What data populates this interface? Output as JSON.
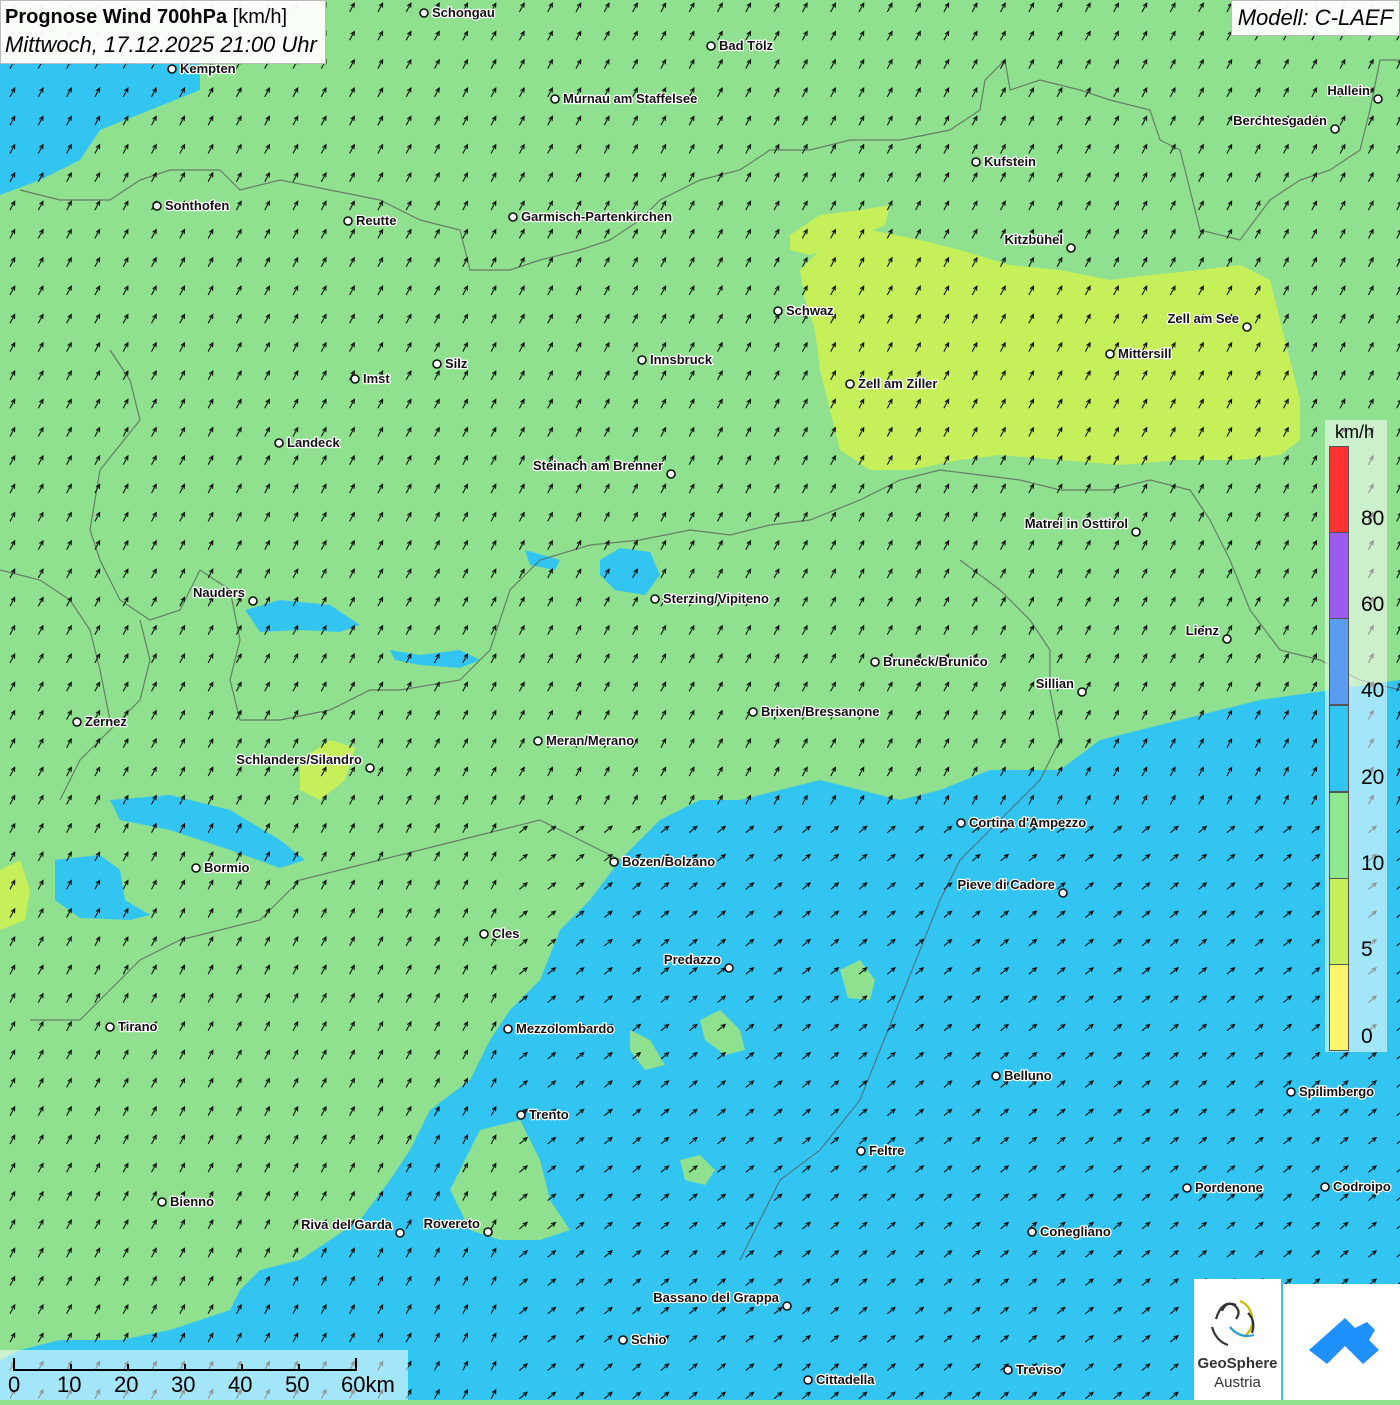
{
  "header": {
    "title_bold": "Prognose Wind 700hPa",
    "title_unit": "[km/h]",
    "date": "Mittwoch, 17.12.2025 21:00 Uhr",
    "model": "Modell: C-LAEF"
  },
  "legend": {
    "unit": "km/h",
    "ticks": [
      "80",
      "60",
      "40",
      "20",
      "10",
      "5",
      "0"
    ],
    "colors": [
      "#ff3333",
      "#9b59f0",
      "#5a9cf2",
      "#33c5f2",
      "#8ee88e",
      "#c6f05a",
      "#fdf66a"
    ]
  },
  "scale": {
    "labels": [
      "0",
      "10",
      "20",
      "30",
      "40",
      "50",
      "60km"
    ]
  },
  "logos": {
    "geosphere_line1": "GeoSphere",
    "geosphere_line2": "Austria",
    "app_icon": "cloud-arrow-icon"
  },
  "colors": {
    "calm": "#fdf66a",
    "light": "#c6f05a",
    "moderate": "#8fe08f",
    "fresh": "#33c5f2"
  },
  "cities": [
    {
      "name": "Schongau",
      "align": "right"
    },
    {
      "name": "Bad Tölz",
      "align": "right"
    },
    {
      "name": "Kempten",
      "align": "right"
    },
    {
      "name": "Murnau am Staffelsee",
      "align": "right"
    },
    {
      "name": "Hallein",
      "align": "left"
    },
    {
      "name": "Berchtesgaden",
      "align": "left"
    },
    {
      "name": "Kufstein",
      "align": "right"
    },
    {
      "name": "Sonthofen",
      "align": "right"
    },
    {
      "name": "Reutte",
      "align": "right"
    },
    {
      "name": "Garmisch-Partenkirchen",
      "align": "right"
    },
    {
      "name": "Kitzbühel",
      "align": "left"
    },
    {
      "name": "Schwaz",
      "align": "right"
    },
    {
      "name": "Zell am See",
      "align": "left"
    },
    {
      "name": "Mittersill",
      "align": "right"
    },
    {
      "name": "Innsbruck",
      "align": "right"
    },
    {
      "name": "Imst",
      "align": "right"
    },
    {
      "name": "Silz",
      "align": "right"
    },
    {
      "name": "Zell am Ziller",
      "align": "right"
    },
    {
      "name": "Landeck",
      "align": "right"
    },
    {
      "name": "Steinach am Brenner",
      "align": "left"
    },
    {
      "name": "Matrei in Osttirol",
      "align": "left"
    },
    {
      "name": "Nauders",
      "align": "left"
    },
    {
      "name": "Sterzing/Vipiteno",
      "align": "right"
    },
    {
      "name": "Lienz",
      "align": "left"
    },
    {
      "name": "Bruneck/Brunico",
      "align": "right"
    },
    {
      "name": "Sillian",
      "align": "left"
    },
    {
      "name": "Zernez",
      "align": "right"
    },
    {
      "name": "Brixen/Bressanone",
      "align": "right"
    },
    {
      "name": "Meran/Merano",
      "align": "right"
    },
    {
      "name": "Schlanders/Silandro",
      "align": "left"
    },
    {
      "name": "Cortina d'Ampezzo",
      "align": "right"
    },
    {
      "name": "Bozen/Bolzano",
      "align": "right"
    },
    {
      "name": "Bormio",
      "align": "right"
    },
    {
      "name": "Pieve di Cadore",
      "align": "left"
    },
    {
      "name": "Cles",
      "align": "right"
    },
    {
      "name": "Predazzo",
      "align": "left"
    },
    {
      "name": "Tirano",
      "align": "right"
    },
    {
      "name": "Mezzolombardo",
      "align": "right"
    },
    {
      "name": "Belluno",
      "align": "right"
    },
    {
      "name": "Spilimbergo",
      "align": "right"
    },
    {
      "name": "Trento",
      "align": "right"
    },
    {
      "name": "Feltre",
      "align": "right"
    },
    {
      "name": "Pordenone",
      "align": "right"
    },
    {
      "name": "Codroipo",
      "align": "right"
    },
    {
      "name": "Bienno",
      "align": "right"
    },
    {
      "name": "Riva del Garda",
      "align": "left"
    },
    {
      "name": "Rovereto",
      "align": "left"
    },
    {
      "name": "Conegliano",
      "align": "right"
    },
    {
      "name": "Bassano del Grappa",
      "align": "left"
    },
    {
      "name": "Schio",
      "align": "right"
    },
    {
      "name": "Treviso",
      "align": "right"
    },
    {
      "name": "Cittadella",
      "align": "right"
    }
  ]
}
